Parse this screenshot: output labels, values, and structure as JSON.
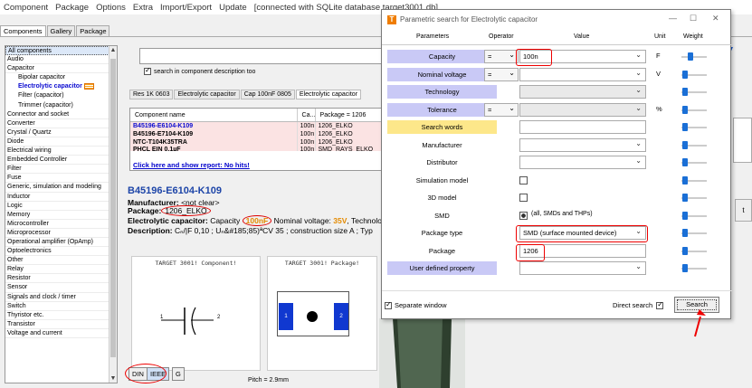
{
  "menubar": {
    "items": [
      "Component",
      "Package",
      "Options",
      "Extra",
      "Import/Export",
      "Update"
    ],
    "status": "[connected with SQLite database target3001.db]"
  },
  "tabs": [
    "Components",
    "Gallery",
    "Package"
  ],
  "categories": [
    "All components",
    "Audio",
    "Capacitor",
    "Bipolar capacitor",
    "Electrolytic capacitor",
    "Filter (capacitor)",
    "Trimmer (capacitor)",
    "Connector and socket",
    "Converter",
    "Crystal / Quartz",
    "Diode",
    "Electrical wiring",
    "Embedded Controller",
    "Filter",
    "Fuse",
    "Generic, simulation and modeling",
    "Inductor",
    "Logic",
    "Memory",
    "Microcontroller",
    "Microprocessor",
    "Operational amplifier (OpAmp)",
    "Optoelectronics",
    "Other",
    "Relay",
    "Resistor",
    "Sensor",
    "Signals and clock / timer",
    "Switch",
    "Thyristor etc.",
    "Transistor",
    "Voltage and current"
  ],
  "search": {
    "desc_label": "search in component description too"
  },
  "subtabs": [
    "Res 1K 0603",
    "Electrolytic capacitor",
    "Cap 100nF 0805",
    "Electrolytic capacitor"
  ],
  "grid": {
    "headers": [
      "Component name",
      "Ca...",
      "Package = 1206"
    ],
    "rows": [
      [
        "B45196-E6104-K109",
        "100n",
        "1206_ELKO"
      ],
      [
        "B45196-E7104-K109",
        "100n",
        "1206_ELKO"
      ],
      [
        "NTC-T104K35TRA",
        "100n",
        "1206_ELKO"
      ],
      [
        "PHCL EIN 0,1µF",
        "100n",
        "SMD_RAYS_ELKO"
      ]
    ],
    "link": "Click here and show report: No hits!"
  },
  "detail": {
    "title": "B45196-E6104-K109",
    "manufacturer_label": "Manufacturer:",
    "manufacturer_value": "<not clear>",
    "package_label": "Package:",
    "package_value": "1206_ELKO",
    "line3_a": "Electrolytic capacitor:",
    "line3_b": "Capacity",
    "line3_cap": "100nF",
    "line3_c": "Nominal voltage:",
    "line3_volt": "35V",
    "line3_d": ", Technolo",
    "line4_a": "Description:",
    "line4_b": "Cₙ/|F 0,10 ; Uₙ&#185;85)ªCV 35 ; construction size A ; Typ"
  },
  "panels": {
    "symbol_title": "TARGET 3001! Component!",
    "package_title": "TARGET 3001! Package!",
    "pad1": "1",
    "pad2": "2",
    "pin1": "1",
    "pin2": "2",
    "pitch": "Pitch = 2.9mm"
  },
  "bottom_buttons": [
    "DIN",
    "IEEE",
    "G"
  ],
  "right_btn": "t",
  "dialog": {
    "title": "Parametric search for Electrolytic capacitor",
    "headers": {
      "parameters": "Parameters",
      "operator": "Operator",
      "value": "Value",
      "unit": "Unit",
      "weight": "Weight"
    },
    "rows": [
      {
        "label": "Capacity",
        "style": "lav",
        "op": "=",
        "value": "100n",
        "unit": "F",
        "kind": "dd",
        "weight": 0.3
      },
      {
        "label": "Nominal voltage",
        "style": "lav",
        "op": "=",
        "value": "",
        "unit": "V",
        "kind": "dd",
        "weight": 0.05
      },
      {
        "label": "Technology",
        "style": "lav",
        "op": "",
        "value": "",
        "unit": "",
        "kind": "dis",
        "weight": 0.05
      },
      {
        "label": "Tolerance",
        "style": "lav",
        "op": "=",
        "value": "",
        "unit": "%",
        "kind": "dis",
        "weight": 0.05
      },
      {
        "label": "Search words",
        "style": "yel",
        "op": "",
        "value": "",
        "unit": "",
        "kind": "text",
        "weight": 0.05
      },
      {
        "label": "Manufacturer",
        "style": "",
        "op": "",
        "value": "",
        "unit": "",
        "kind": "dd",
        "weight": 0.05
      },
      {
        "label": "Distributor",
        "style": "",
        "op": "",
        "value": "",
        "unit": "",
        "kind": "dd",
        "weight": 0.05
      },
      {
        "label": "Simulation model",
        "style": "",
        "op": "",
        "value": "",
        "unit": "",
        "kind": "cb",
        "weight": 0.05
      },
      {
        "label": "3D model",
        "style": "",
        "op": "",
        "value": "",
        "unit": "",
        "kind": "cb",
        "weight": 0.05
      },
      {
        "label": "SMD",
        "style": "",
        "op": "",
        "value": "(all, SMDs and THPs)",
        "unit": "",
        "kind": "cbfill",
        "weight": 0.05
      },
      {
        "label": "Package type",
        "style": "",
        "op": "",
        "value": "SMD (surface mounted device)",
        "unit": "",
        "kind": "dd",
        "weight": 0.05
      },
      {
        "label": "Package",
        "style": "",
        "op": "",
        "value": "1206",
        "unit": "",
        "kind": "text",
        "weight": 0.05
      },
      {
        "label": "User defined property",
        "style": "lav",
        "op": "",
        "value": "",
        "unit": "",
        "kind": "dd",
        "weight": 0.05
      }
    ],
    "separate_window": "Separate window",
    "direct_search": "Direct search",
    "search_button": "Search"
  },
  "colors": {
    "lavender": "#c9c9f6",
    "yellow": "#fde78a",
    "highlight": "#e00000",
    "link": "#0000cc"
  }
}
